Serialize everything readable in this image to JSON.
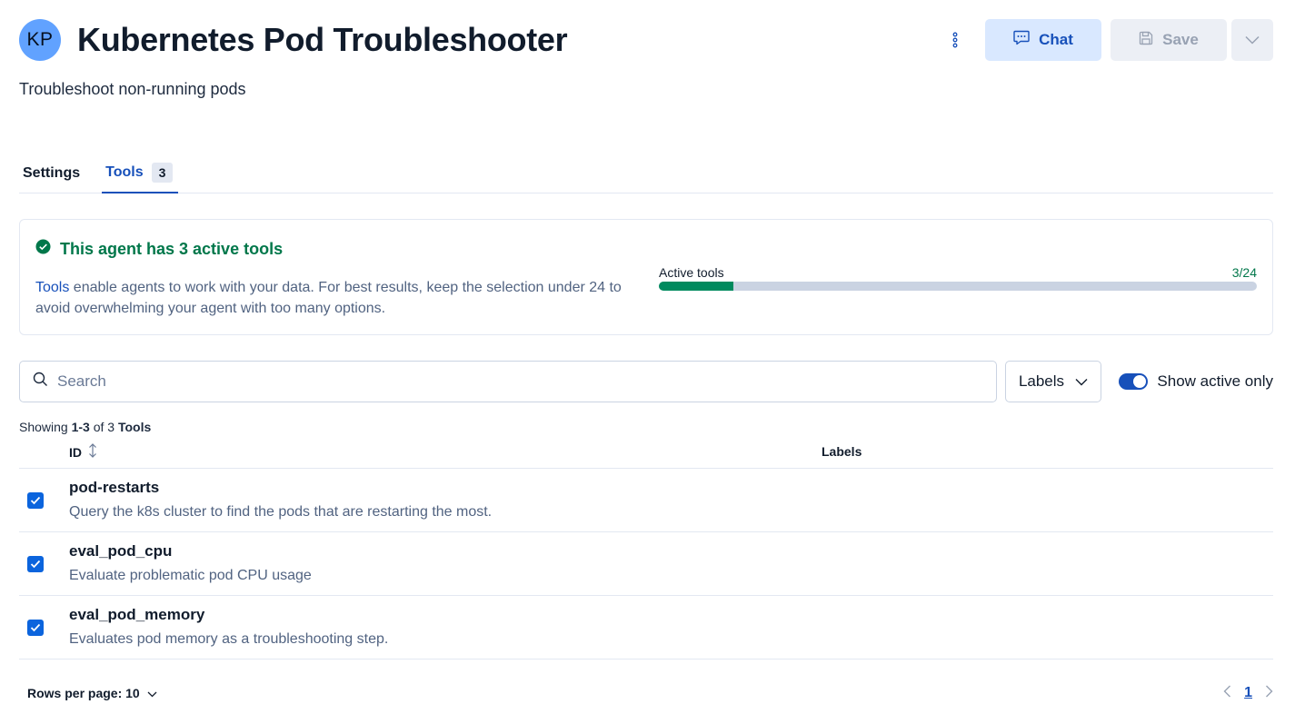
{
  "header": {
    "avatar_initials": "KP",
    "title": "Kubernetes Pod Troubleshooter",
    "subtitle": "Troubleshoot non-running pods",
    "chat_label": "Chat",
    "save_label": "Save",
    "icons": [
      "kebab-menu-icon",
      "chat-bubble-icon",
      "save-disk-icon",
      "chevron-down-icon"
    ]
  },
  "tabs": [
    {
      "label": "Settings",
      "active": false
    },
    {
      "label": "Tools",
      "count": "3",
      "active": true
    }
  ],
  "summary": {
    "title": "This agent has 3 active tools",
    "text_link": "Tools",
    "text_body": " enable agents to work with your data. For best results, keep the selection under 24 to avoid overwhelming your agent with too many options.",
    "progress_label": "Active tools",
    "progress_value_text": "3/24",
    "progress_fraction": 0.125,
    "success_color": "#00774a"
  },
  "controls": {
    "search_placeholder": "Search",
    "labels_button": "Labels",
    "toggle_label": "Show active only",
    "toggle_on": true
  },
  "showing": {
    "prefix": "Showing ",
    "range": "1-3",
    "middle": " of 3 ",
    "noun": "Tools"
  },
  "table": {
    "columns": {
      "id": "ID",
      "labels": "Labels"
    },
    "rows": [
      {
        "id": "pod-restarts",
        "description": "Query the k8s cluster to find the pods that are restarting the most.",
        "checked": true
      },
      {
        "id": "eval_pod_cpu",
        "description": "Evaluate problematic pod CPU usage",
        "checked": true
      },
      {
        "id": "eval_pod_memory",
        "description": "Evaluates pod memory as a troubleshooting step.",
        "checked": true
      }
    ]
  },
  "footer": {
    "rows_per_page": "Rows per page: 10",
    "current_page": "1"
  },
  "colors": {
    "accent": "#1750ba",
    "checkbox": "#0b64dd",
    "avatar": "#61a2ff"
  }
}
